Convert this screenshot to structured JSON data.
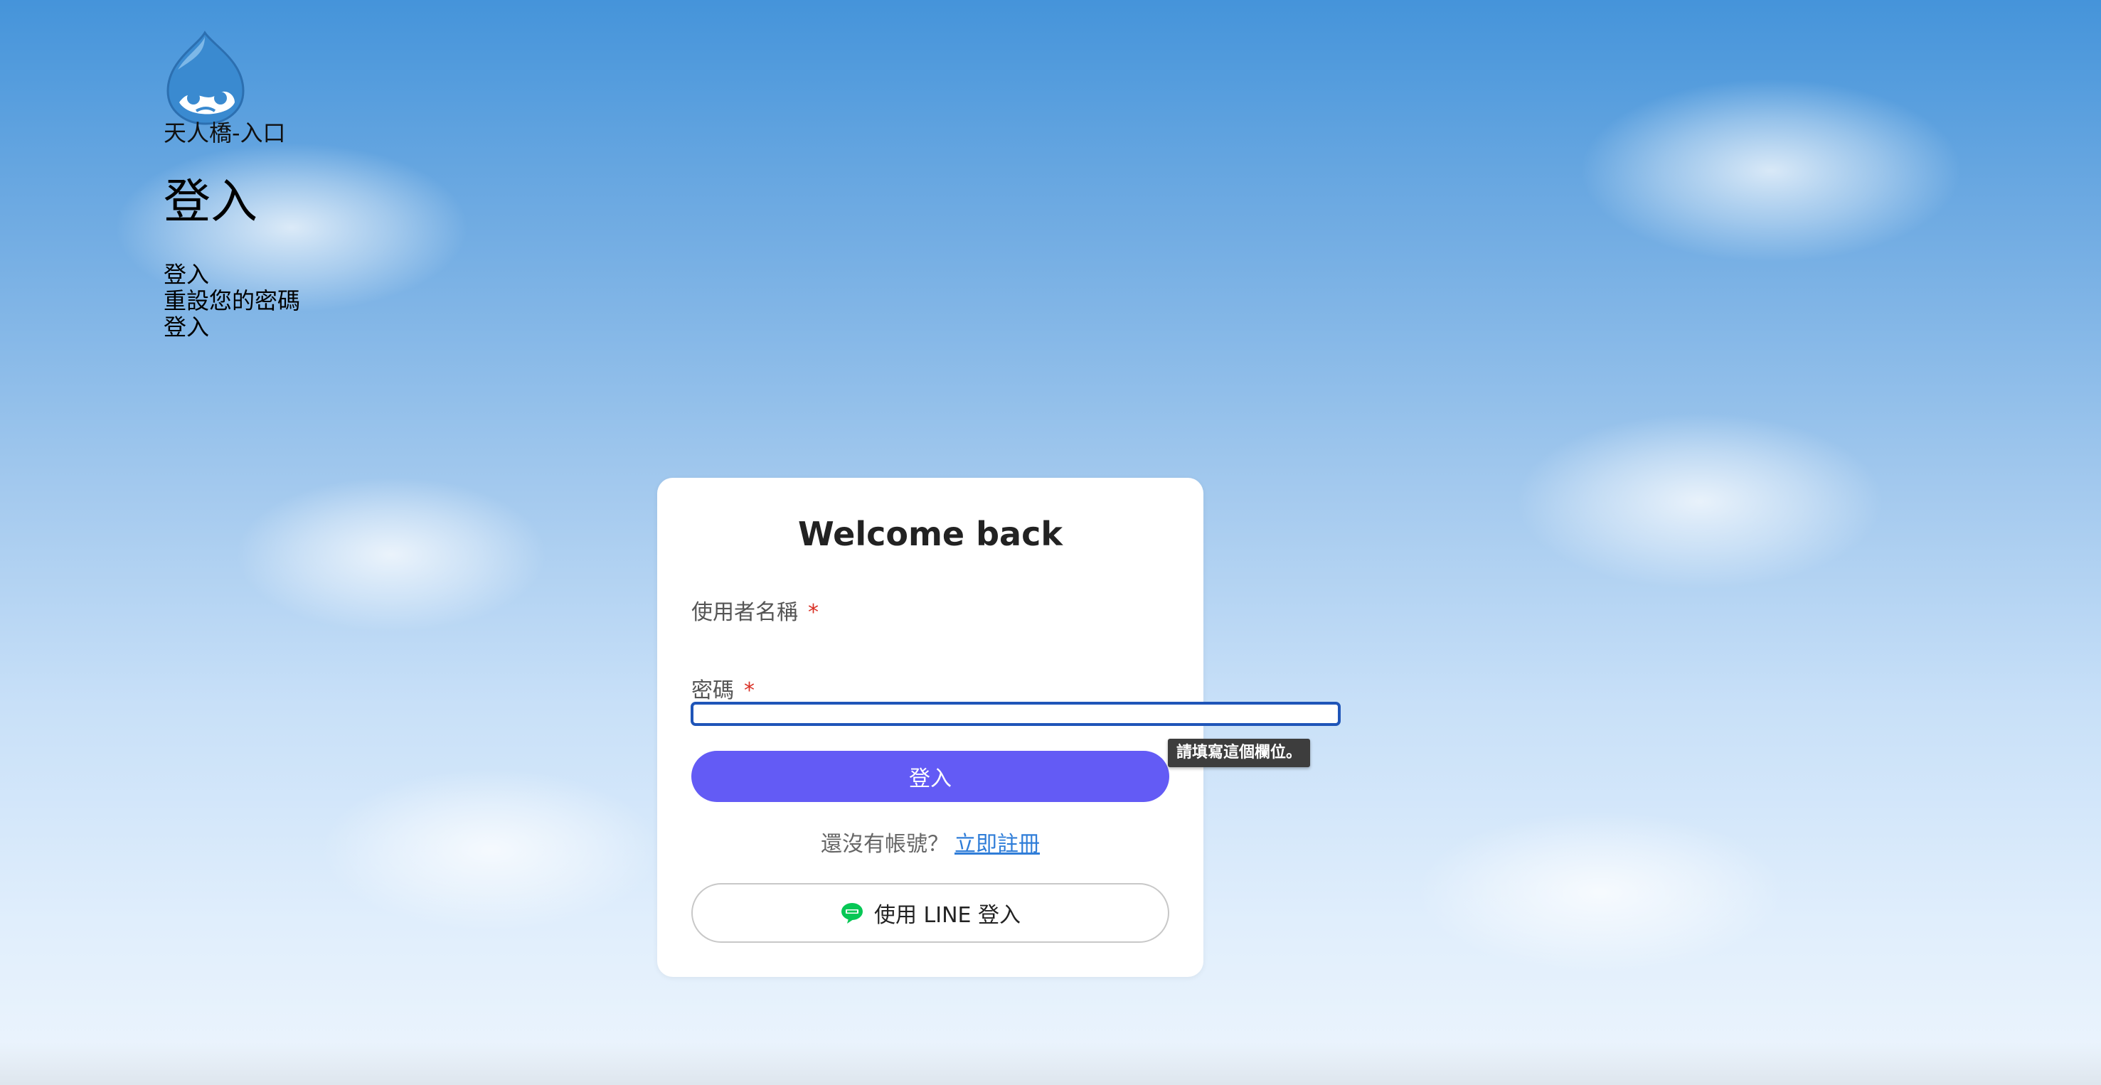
{
  "site": {
    "name": "天人橋-入口",
    "logo_icon": "drupal-drop-logo"
  },
  "page": {
    "heading": "登入"
  },
  "local_links": [
    "登入",
    "重設您的密碼",
    "登入"
  ],
  "login_form": {
    "title": "Welcome back",
    "username_label": "使用者名稱",
    "username_required_mark": "*",
    "username_value": "",
    "password_label": "密碼",
    "password_required_mark": "*",
    "password_value": "",
    "validation_tooltip": "請填寫這個欄位。",
    "submit_label": "登入",
    "register_prompt": "還沒有帳號？",
    "register_link": "立即註冊",
    "line_login_label": "使用 LINE 登入",
    "line_icon": "line-chat-icon"
  },
  "colors": {
    "primary_button": "#635bf5",
    "link": "#2f7dd8",
    "required": "#d93025",
    "focus_border": "#1f55b8",
    "line_brand": "#06c755"
  }
}
